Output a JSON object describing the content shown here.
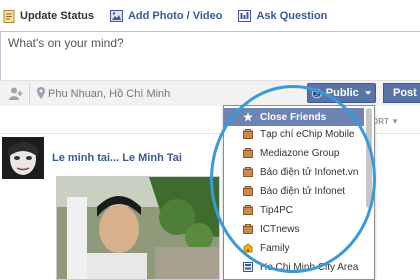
{
  "tabs": [
    {
      "label": "Update Status",
      "icon": "status-icon"
    },
    {
      "label": "Add Photo / Video",
      "icon": "photo-icon"
    },
    {
      "label": "Ask Question",
      "icon": "question-icon"
    }
  ],
  "composer": {
    "placeholder": "What's on your mind?",
    "location": "Phu Nhuan, Hồ Chí Minh"
  },
  "audience_button": {
    "label": "Public",
    "icon": "globe-icon"
  },
  "post_button": {
    "label": "Post"
  },
  "sort_label": "ORT",
  "post": {
    "author_line": "Le minh tai... Le Minh Tai"
  },
  "dropdown": {
    "header": "Close Friends",
    "items": [
      "Tạp chí eChip Mobile",
      "Mediazone Group",
      "Báo điện tử Infonet.vn",
      "Báo điện tử Infonet",
      "Tip4PC",
      "ICTnews",
      "Family",
      "Ho Chi Minh City Area"
    ]
  },
  "colors": {
    "brand": "#3b5998",
    "button": "#5b74a8",
    "highlight_circle": "#3a9ad9",
    "menu_header": "#6d84b4"
  }
}
